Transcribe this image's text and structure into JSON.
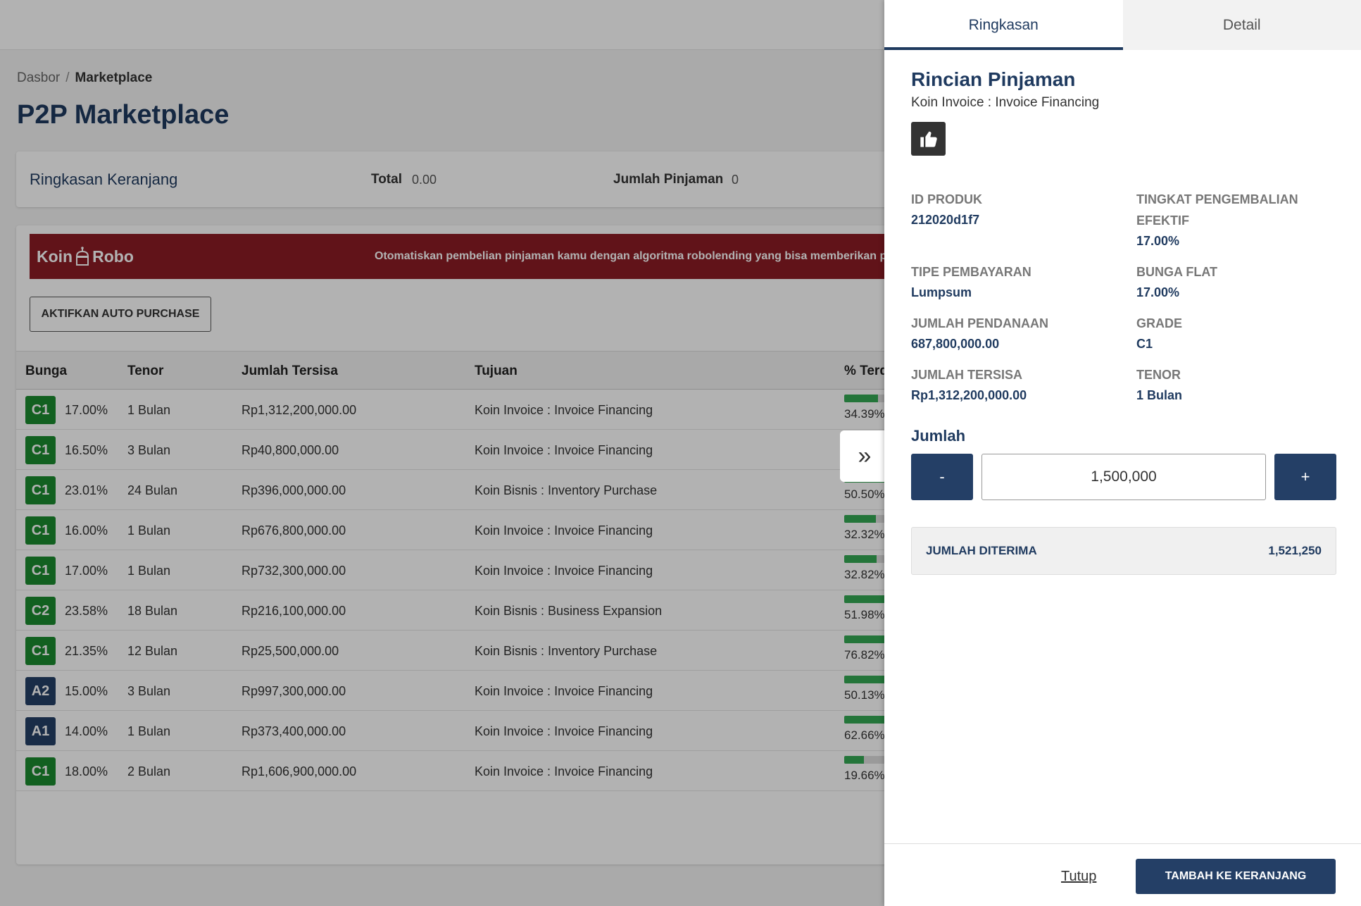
{
  "breadcrumb": {
    "home": "Dasbor",
    "separator": "/",
    "current": "Marketplace"
  },
  "page_title": "P2P Marketplace",
  "cart_summary": {
    "title": "Ringkasan Keranjang",
    "total_label": "Total",
    "total_value": "0.00",
    "count_label": "Jumlah Pinjaman",
    "count_value": "0"
  },
  "robo_banner": {
    "logo_text_left": "Koin",
    "logo_text_right": "Robo",
    "message": "Otomatiskan pembelian pinjaman kamu dengan algoritma robolending yang bisa memberikan pe"
  },
  "auto_purchase_button": "AKTIFKAN AUTO PURCHASE",
  "table": {
    "headers": [
      "Bunga",
      "Tenor",
      "Jumlah Tersisa",
      "Tujuan",
      "% Terd"
    ],
    "rows": [
      {
        "grade": "C1",
        "grade_color": "#1a8a2e",
        "rate": "17.00%",
        "tenor": "1 Bulan",
        "remaining": "Rp1,312,200,000.00",
        "purpose": "Koin Invoice : Invoice Financing",
        "pct": "34.39%",
        "fill": 0.34
      },
      {
        "grade": "C1",
        "grade_color": "#1a8a2e",
        "rate": "16.50%",
        "tenor": "3 Bulan",
        "remaining": "Rp40,800,000.00",
        "purpose": "Koin Invoice : Invoice Financing",
        "pct": "",
        "fill": 0.9
      },
      {
        "grade": "C1",
        "grade_color": "#1a8a2e",
        "rate": "23.01%",
        "tenor": "24 Bulan",
        "remaining": "Rp396,000,000.00",
        "purpose": "Koin Bisnis : Inventory Purchase",
        "pct": "50.50%",
        "fill": 0.5
      },
      {
        "grade": "C1",
        "grade_color": "#1a8a2e",
        "rate": "16.00%",
        "tenor": "1 Bulan",
        "remaining": "Rp676,800,000.00",
        "purpose": "Koin Invoice : Invoice Financing",
        "pct": "32.32%",
        "fill": 0.32
      },
      {
        "grade": "C1",
        "grade_color": "#1a8a2e",
        "rate": "17.00%",
        "tenor": "1 Bulan",
        "remaining": "Rp732,300,000.00",
        "purpose": "Koin Invoice : Invoice Financing",
        "pct": "32.82%",
        "fill": 0.33
      },
      {
        "grade": "C2",
        "grade_color": "#1a8a2e",
        "rate": "23.58%",
        "tenor": "18 Bulan",
        "remaining": "Rp216,100,000.00",
        "purpose": "Koin Bisnis : Business Expansion",
        "pct": "51.98%",
        "fill": 0.52
      },
      {
        "grade": "C1",
        "grade_color": "#1a8a2e",
        "rate": "21.35%",
        "tenor": "12 Bulan",
        "remaining": "Rp25,500,000.00",
        "purpose": "Koin Bisnis : Inventory Purchase",
        "pct": "76.82%",
        "fill": 0.77
      },
      {
        "grade": "A2",
        "grade_color": "#243f66",
        "rate": "15.00%",
        "tenor": "3 Bulan",
        "remaining": "Rp997,300,000.00",
        "purpose": "Koin Invoice : Invoice Financing",
        "pct": "50.13%",
        "fill": 0.5
      },
      {
        "grade": "A1",
        "grade_color": "#243f66",
        "rate": "14.00%",
        "tenor": "1 Bulan",
        "remaining": "Rp373,400,000.00",
        "purpose": "Koin Invoice : Invoice Financing",
        "pct": "62.66%",
        "fill": 0.63
      },
      {
        "grade": "C1",
        "grade_color": "#1a8a2e",
        "rate": "18.00%",
        "tenor": "2 Bulan",
        "remaining": "Rp1,606,900,000.00",
        "purpose": "Koin Invoice : Invoice Financing",
        "pct": "19.66%",
        "fill": 0.2
      }
    ]
  },
  "drawer": {
    "tabs": {
      "summary": "Ringkasan",
      "detail": "Detail"
    },
    "title": "Rincian Pinjaman",
    "subtitle": "Koin Invoice : Invoice Financing",
    "fields": {
      "product_id_label": "ID PRODUK",
      "product_id_value": "212020d1f7",
      "effective_return_label_1": "TINGKAT PENGEMBALIAN",
      "effective_return_label_2": "EFEKTIF",
      "effective_return_value": "17.00%",
      "payment_type_label": "TIPE PEMBAYARAN",
      "payment_type_value": "Lumpsum",
      "flat_rate_label": "BUNGA FLAT",
      "flat_rate_value": "17.00%",
      "funding_label": "JUMLAH PENDANAAN",
      "funding_value": "687,800,000.00",
      "grade_label": "GRADE",
      "grade_value": "C1",
      "remaining_label": "JUMLAH TERSISA",
      "remaining_value": "Rp1,312,200,000.00",
      "tenor_label": "TENOR",
      "tenor_value": "1 Bulan"
    },
    "amount_label": "Jumlah",
    "minus": "-",
    "plus": "+",
    "amount_value": "1,500,000",
    "received_label": "JUMLAH DITERIMA",
    "received_value": "1,521,250",
    "close": "Tutup",
    "add_to_cart": "TAMBAH KE KERANJANG"
  },
  "colors": {
    "primary": "#243f66",
    "title": "#1f3a5f",
    "banner": "#8b1c24",
    "grade_green": "#1a8a2e",
    "progress": "#34a853"
  }
}
